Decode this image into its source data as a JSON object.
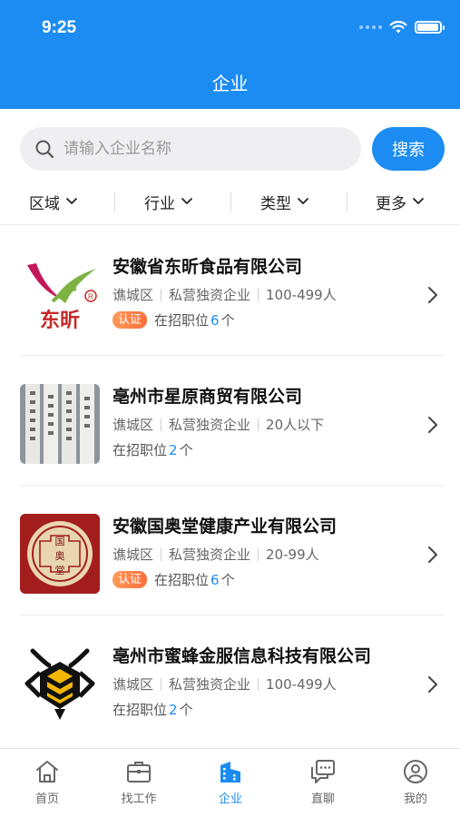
{
  "status_bar": {
    "time": "9:25",
    "battery_level": 0.95
  },
  "header": {
    "title": "企业"
  },
  "search": {
    "placeholder": "请输入企业名称",
    "button_label": "搜索"
  },
  "filters": [
    {
      "label": "区域"
    },
    {
      "label": "行业"
    },
    {
      "label": "类型"
    },
    {
      "label": "更多"
    }
  ],
  "companies": [
    {
      "name": "安徽省东昕食品有限公司",
      "district": "谯城区",
      "type": "私营独资企业",
      "size": "100-499人",
      "verified": true,
      "badge_label": "认证",
      "jobs_prefix": "在招职位",
      "jobs_count": "6",
      "jobs_suffix": "个",
      "logo_text": "东昕"
    },
    {
      "name": "亳州市星原商贸有限公司",
      "district": "谯城区",
      "type": "私营独资企业",
      "size": "20人以下",
      "verified": false,
      "badge_label": "",
      "jobs_prefix": "在招职位",
      "jobs_count": "2",
      "jobs_suffix": "个",
      "logo_text": ""
    },
    {
      "name": "安徽国奥堂健康产业有限公司",
      "district": "谯城区",
      "type": "私营独资企业",
      "size": "20-99人",
      "verified": true,
      "badge_label": "认证",
      "jobs_prefix": "在招职位",
      "jobs_count": "6",
      "jobs_suffix": "个",
      "logo_text": "国奥堂"
    },
    {
      "name": "亳州市蜜蜂金服信息科技有限公司",
      "district": "谯城区",
      "type": "私营独资企业",
      "size": "100-499人",
      "verified": false,
      "badge_label": "",
      "jobs_prefix": "在招职位",
      "jobs_count": "2",
      "jobs_suffix": "个",
      "logo_text": ""
    }
  ],
  "tabbar": [
    {
      "label": "首页",
      "icon": "home-icon",
      "active": false
    },
    {
      "label": "找工作",
      "icon": "briefcase-icon",
      "active": false
    },
    {
      "label": "企业",
      "icon": "buildings-icon",
      "active": true
    },
    {
      "label": "直聊",
      "icon": "chat-icon",
      "active": false
    },
    {
      "label": "我的",
      "icon": "profile-icon",
      "active": false
    }
  ],
  "colors": {
    "primary": "#1C8CF2",
    "badge": "#FF7A45",
    "text": "#111111",
    "muted": "#666666"
  }
}
